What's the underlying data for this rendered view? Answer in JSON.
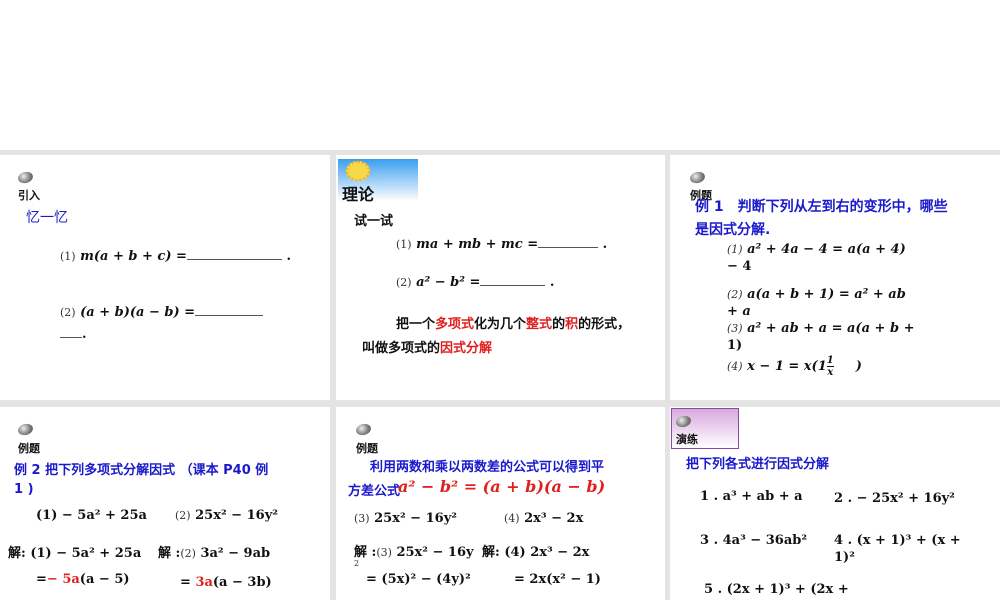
{
  "p1": {
    "tag": "引入",
    "title": "忆一忆",
    "q1n": "(1)",
    "q1": "m(a + b + c) =",
    "q1end": ".",
    "q2n": "(2)",
    "q2": "(a + b)(a − b) =",
    "q2end": "."
  },
  "p2": {
    "tag": "理论",
    "sub": "试一试",
    "q1n": "(1)",
    "q1": "ma + mb + mc =",
    "q1end": ".",
    "q2n": "(2)",
    "q2": "a² − b² =",
    "q2end": ".",
    "def": [
      "把一个",
      "多项式",
      "化为几个",
      "整式",
      "的",
      "积",
      "的形式，"
    ],
    "def2": [
      "叫做多项式的",
      "因式分解"
    ]
  },
  "p3": {
    "tag": "例题",
    "title1": "例 1　判断下列从左到右的变形中，哪些",
    "title2": "是因式分解.",
    "items": [
      {
        "n": "(1)",
        "a": "a² + 4a − 4 = a(a + 4)",
        "b": "− 4"
      },
      {
        "n": "(2)",
        "a": "a(a + b + 1) = a² + ab",
        "b": "+ a"
      },
      {
        "n": "(3)",
        "a": "a² + ab + a = a(a + b +",
        "b": "1)"
      },
      {
        "n": "(4)",
        "a": "x − 1 = x(1",
        "frac_num": "1",
        "frac_den": "x",
        "c": ")"
      }
    ]
  },
  "p4": {
    "tag": "例题",
    "title1": "例 2  把下列多项式分解因式 （课本 P40  例",
    "title2": "1 )",
    "e1": "(1)  − 5a² + 25a",
    "e2n": "(2)",
    "e2": "25x² − 16y²",
    "s1": "解: (1) − 5a² + 25a",
    "s2a": "解 :",
    "s2n": "(2)",
    "s2": "3a² − 9ab",
    "r1a": "=",
    "r1red": "− 5a",
    "r1b": "(a − 5)",
    "r2a": "=",
    "r2red": "3a",
    "r2b": "(a − 3b)"
  },
  "p5": {
    "tag": "例题",
    "title1": "利用两数和乘以两数差的公式可以得到平",
    "title2": "方差公式",
    "formula": "a² − b² = (a + b)(a − b)",
    "e3n": "(3)",
    "e3": "25x² − 16y²",
    "e4n": "(4)",
    "e4": "2x³ − 2x",
    "s3a": "解 :",
    "s3n": "(3)",
    "s3": "25x² − 16y",
    "s3sup": "2",
    "s4": "解: (4)  2x³ − 2x",
    "r3": "= (5x)² − (4y)²",
    "r4": "= 2x(x² − 1)"
  },
  "p6": {
    "tag": "演练",
    "title": "把下列各式进行因式分解",
    "i1": "1 .  a³ + ab + a",
    "i2": "2 .  − 25x² + 16y²",
    "i3": "3 .  4a³ − 36ab²",
    "i4a": "4 .  (x + 1)³ + (x +",
    "i4b": "1)²",
    "i5": "5 .  (2x + 1)³ + (2x +"
  }
}
